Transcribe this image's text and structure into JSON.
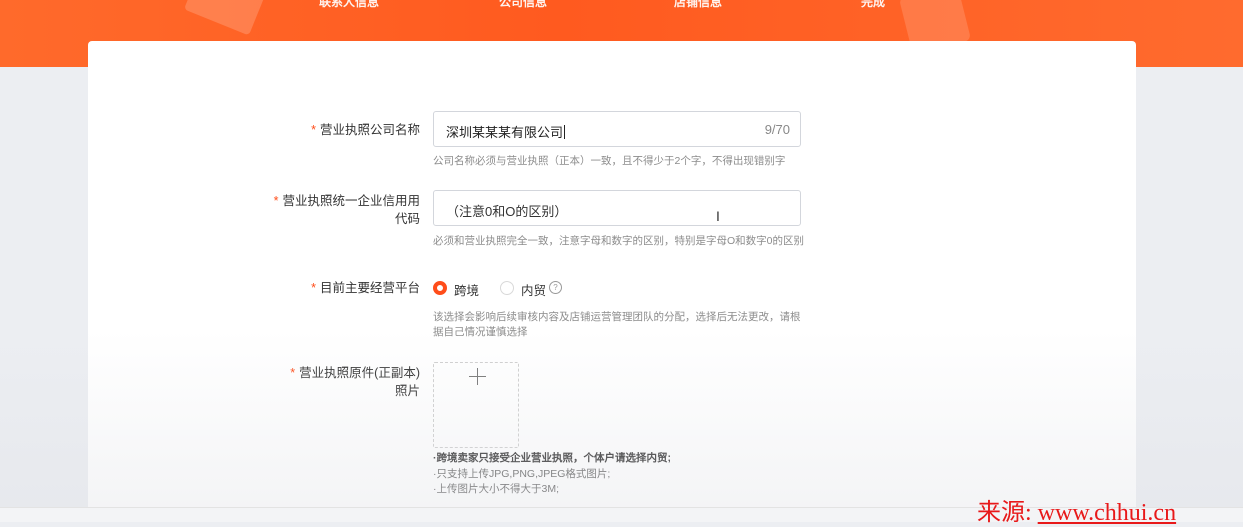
{
  "steps": [
    "联系人信息",
    "公司信息",
    "店铺信息",
    "完成"
  ],
  "form": {
    "company_name": {
      "label": "营业执照公司名称",
      "value": "深圳某某某有限公司",
      "count": "9/70",
      "hint": "公司名称必须与营业执照（正本）一致，且不得少于2个字，不得出现错别字"
    },
    "credit_code": {
      "label_line1": "营业执照统一企业信用用",
      "label_line2": "代码",
      "placeholder": "（注意0和O的区别）",
      "hint": "必须和营业执照完全一致，注意字母和数字的区别，特别是字母O和数字0的区别"
    },
    "platform": {
      "label": "目前主要经营平台",
      "options": [
        "跨境",
        "内贸"
      ],
      "selected": "跨境",
      "help_icon": "question-circle-icon",
      "hint_line1": "该选择会影响后续审核内容及店铺运营管理团队的分配，选择后无法更改，请根",
      "hint_line2": "据自己情况谨慎选择"
    },
    "license_photo": {
      "label_line1": "营业执照原件(正副本)",
      "label_line2": "照片",
      "upload_icon": "plus-icon",
      "notes": [
        "·跨境卖家只接受企业营业执照，个体户请选择内贸;",
        "·只支持上传JPG,PNG,JPEG格式图片;",
        "·上传图片大小不得大于3M;"
      ]
    }
  },
  "required_mark": "*",
  "watermark": {
    "prefix": "来源: ",
    "url": "www.chhui.cn"
  },
  "colors": {
    "brand": "#ff5a1f",
    "required": "#ff4d1a",
    "watermark": "#e8191a"
  }
}
